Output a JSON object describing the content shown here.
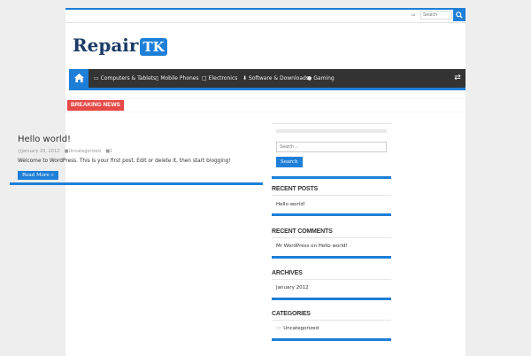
{
  "topbar": {
    "rss_icon": "rss-icon",
    "search_placeholder": "Search",
    "search_icon": "search-icon"
  },
  "logo": {
    "text": "Repair",
    "badge": "TK",
    "tagline": "Repair TK"
  },
  "nav": {
    "home_icon": "home-icon",
    "items": [
      {
        "label": "Computers & Tablets",
        "icon": "laptop-icon"
      },
      {
        "label": "Mobile Phones",
        "icon": "mobile-icon"
      },
      {
        "label": "Electronics",
        "icon": "monitor-icon"
      },
      {
        "label": "Software & Downloads",
        "icon": "download-icon"
      },
      {
        "label": "Gaming",
        "icon": "gamepad-icon"
      }
    ],
    "random_icon": "shuffle-icon"
  },
  "breaking": {
    "label": "BREAKING NEWS"
  },
  "post": {
    "title": "Hello world!",
    "date": "January 20, 2012",
    "category": "Uncategorized",
    "comments": "1",
    "excerpt": "Welcome to WordPress. This is your first post. Edit or delete it, then start blogging!",
    "read_more": "Read More »"
  },
  "sidebar": {
    "search_placeholder": "Search ...",
    "search_button": "Search",
    "widgets": [
      {
        "title": "Recent Posts",
        "items": [
          "Hello world!"
        ]
      },
      {
        "title": "Recent Comments",
        "items": [
          "Mr WordPress on Hello world!"
        ]
      },
      {
        "title": "Archives",
        "items": [
          "January 2012"
        ]
      },
      {
        "title": "Categories",
        "items": [
          "Uncategorized"
        ]
      }
    ]
  },
  "colors": {
    "accent": "#1e7fd8",
    "nav_bg": "#333333",
    "breaking": "#e64946"
  }
}
